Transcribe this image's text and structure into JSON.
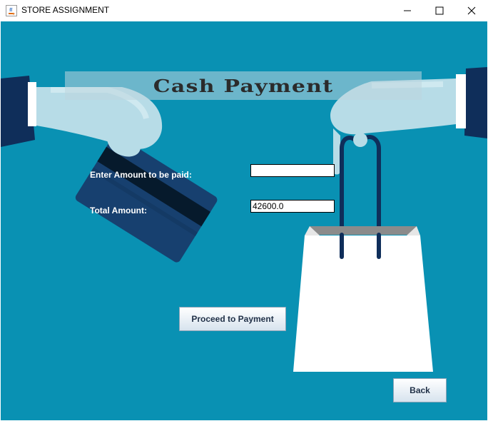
{
  "window": {
    "title": "STORE ASSIGNMENT"
  },
  "banner": {
    "title": "Cash Payment"
  },
  "form": {
    "amount_label": "Enter Amount to be paid:",
    "amount_value": "",
    "total_label": "Total Amount:",
    "total_value": "42600.0"
  },
  "buttons": {
    "proceed": "Proceed to Payment",
    "back": "Back"
  },
  "colors": {
    "background": "#0991b3",
    "sleeve": "#0f2e5a",
    "card": "#17406f",
    "bag": "#ffffff"
  }
}
